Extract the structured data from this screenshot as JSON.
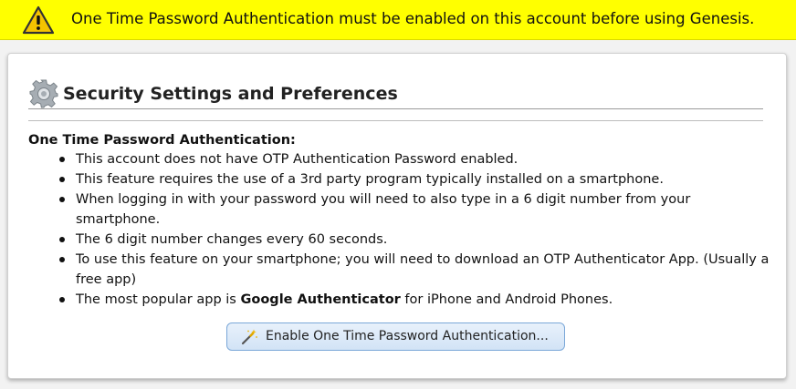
{
  "warning": {
    "icon": "warning-icon",
    "text": "One Time Password Authentication must be enabled on this account before using Genesis.",
    "background": "#ffff00"
  },
  "panel": {
    "icon": "gear-icon",
    "title": "Security Settings and Preferences",
    "section_heading": "One Time Password Authentication:",
    "bullets": [
      {
        "text": "This account does not have OTP Authentication Password enabled."
      },
      {
        "text": "This feature requires the use of a 3rd party program typically installed on a smartphone."
      },
      {
        "text": "When logging in with your password you will need to also type in a 6 digit number from your smartphone."
      },
      {
        "text": "The 6 digit number changes every 60 seconds."
      },
      {
        "text": "To use this feature on your smartphone; you will need to download an OTP Authenticator App. (Usually a free app)"
      },
      {
        "prefix": "The most popular app is ",
        "bold": "Google Authenticator",
        "suffix": " for iPhone and Android Phones."
      }
    ],
    "button": {
      "icon": "magic-wand-icon",
      "label": "Enable One Time Password Authentication..."
    }
  }
}
